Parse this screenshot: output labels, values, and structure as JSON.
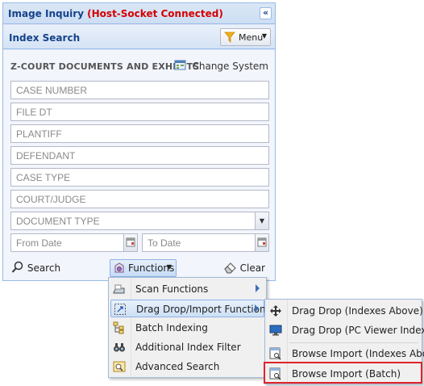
{
  "panel": {
    "title": "Image Inquiry",
    "status": "(Host-Socket Connected)",
    "collapse_glyph": "«",
    "subtitle": "Index Search",
    "menu_label": "Menu",
    "system_name": "Z-COURT DOCUMENTS AND EXHIBITS",
    "change_system": "Change System"
  },
  "fields": {
    "case_number": "CASE NUMBER",
    "file_dt": "FILE DT",
    "plantiff": "PLANTIFF",
    "defendant": "DEFENDANT",
    "case_type": "CASE TYPE",
    "court_judge": "COURT/JUDGE",
    "document_type": "DOCUMENT TYPE",
    "from_date": "From Date",
    "to_date": "To Date"
  },
  "buttons": {
    "search": "Search",
    "functions": "Functions",
    "clear": "Clear"
  },
  "functions_menu": {
    "items": [
      {
        "label": "Scan Functions",
        "icon": "scanner-icon",
        "submenu": true
      },
      {
        "label": "Drag Drop/Import Functions",
        "icon": "drag-drop-icon",
        "submenu": true,
        "active": true
      },
      {
        "label": "Batch Indexing",
        "icon": "tree-icon"
      },
      {
        "label": "Additional Index Filter",
        "icon": "binoculars-icon"
      },
      {
        "label": "Advanced Search",
        "icon": "magnifier-window-icon"
      }
    ]
  },
  "import_submenu": {
    "items": [
      {
        "label": "Drag Drop (Indexes Above)",
        "icon": "move-arrows-icon"
      },
      {
        "label": "Drag Drop (PC Viewer Indexes)",
        "icon": "monitor-icon"
      },
      {
        "label": "Browse Import (Indexes Above)",
        "icon": "browse-import-icon"
      },
      {
        "label": "Browse Import (Batch)",
        "icon": "browse-import-icon",
        "highlighted": true
      }
    ]
  },
  "colors": {
    "status_red": "#d40000",
    "header_blue": "#15428b",
    "highlight_red": "#e0222a"
  }
}
